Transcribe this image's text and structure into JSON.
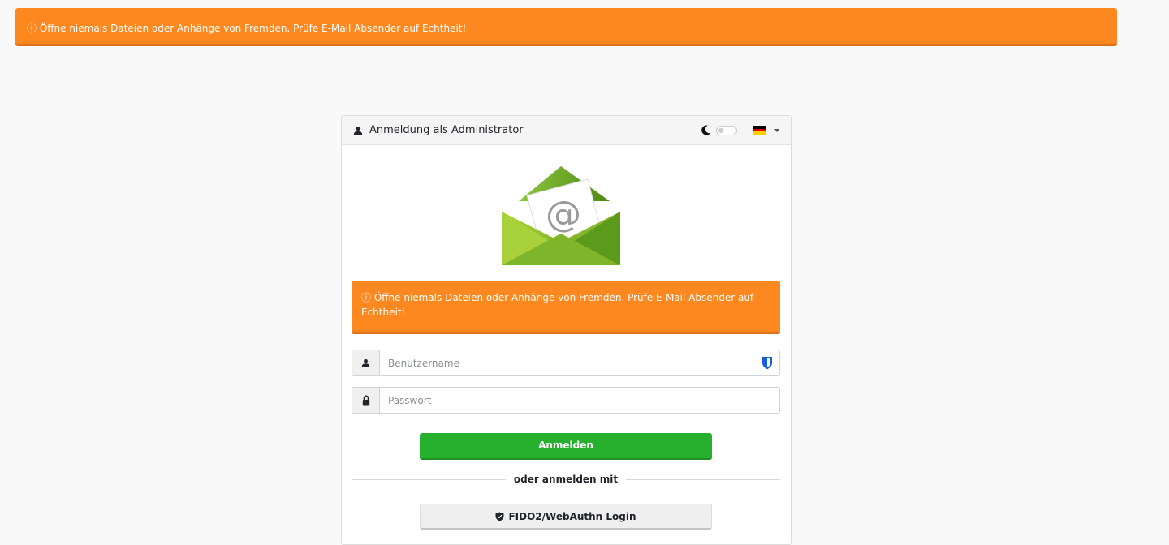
{
  "top_banner": {
    "text": "ⓘ Öffne niemals Dateien oder Anhänge von Fremden. Prüfe E-Mail Absender auf Echtheit!"
  },
  "card": {
    "header_title": "Anmeldung als Administrator",
    "alert_text": "ⓘ Öffne niemals Dateien oder Anhänge von Fremden. Prüfe E-Mail Absender auf Echtheit!",
    "username_placeholder": "Benutzername",
    "password_placeholder": "Passwort",
    "login_button": "Anmelden",
    "divider_text": "oder anmelden mit",
    "fido_button": "FIDO2/WebAuthn Login"
  },
  "icons": {
    "dark_mode": "moon-icon",
    "language": "german-flag-icon",
    "user": "user-icon",
    "lock": "lock-icon",
    "password_manager": "bitwarden-shield-icon",
    "fido": "shield-check-icon",
    "logo": "envelope-at-logo"
  },
  "colors": {
    "alert_orange": "#fd881f",
    "login_green": "#27b02e",
    "bitwarden_blue": "#175ddc"
  },
  "dark_mode_enabled": false
}
